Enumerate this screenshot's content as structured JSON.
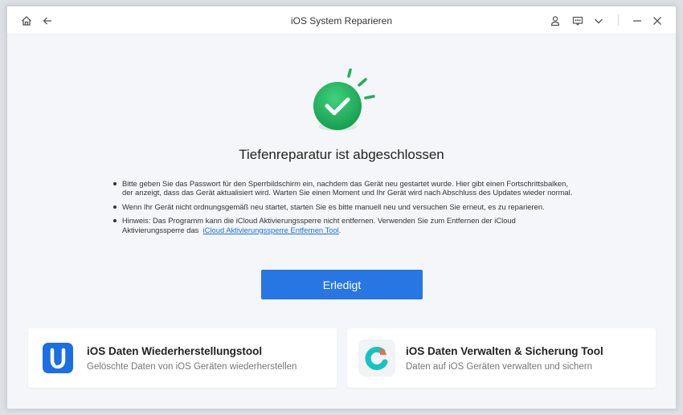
{
  "window": {
    "title": "iOS System Reparieren"
  },
  "titlebar_icons": [
    "home-icon",
    "back-arrow-icon",
    "user-icon",
    "feedback-icon",
    "chevron-down-icon",
    "minimize-icon",
    "close-icon"
  ],
  "main": {
    "heading": "Tiefenreparatur ist abgeschlossen",
    "notes": [
      "Bitte geben Sie das Passwort für den Sperrbildschirm ein, nachdem das Gerät neu gestartet wurde. Hier gibt einen Fortschrittsbalken, der anzeigt, dass das Gerät aktualisiert wird. Warten Sie einen Moment und Ihr Gerät wird nach Abschluss des Updates wieder normal.",
      "Wenn Ihr Gerät nicht ordnungsgemäß neu startet, starten Sie es bitte manuell neu und versuchen Sie erneut, es zu reparieren."
    ],
    "hint_text": "Hinweis: Das Programm kann die iCloud Aktivierungssperre nicht entfernen. Verwenden Sie zum Entfernen der iCloud Aktivierungssperre das",
    "hint_link": "iCloud Aktivierungssperre Entfernen Tool",
    "hint_end": ".",
    "done_button": "Erledigt"
  },
  "cards": [
    {
      "title": "iOS Daten Wiederherstellungstool",
      "subtitle": "Gelöschte Daten von iOS Geräten wiederherstellen"
    },
    {
      "title": "iOS Daten Verwalten & Sicherung Tool",
      "subtitle": "Daten auf iOS Geräten verwalten und sichern"
    }
  ],
  "colors": {
    "accent": "#2876e3",
    "success": "#1fae5d",
    "link": "#1a6fdc"
  }
}
